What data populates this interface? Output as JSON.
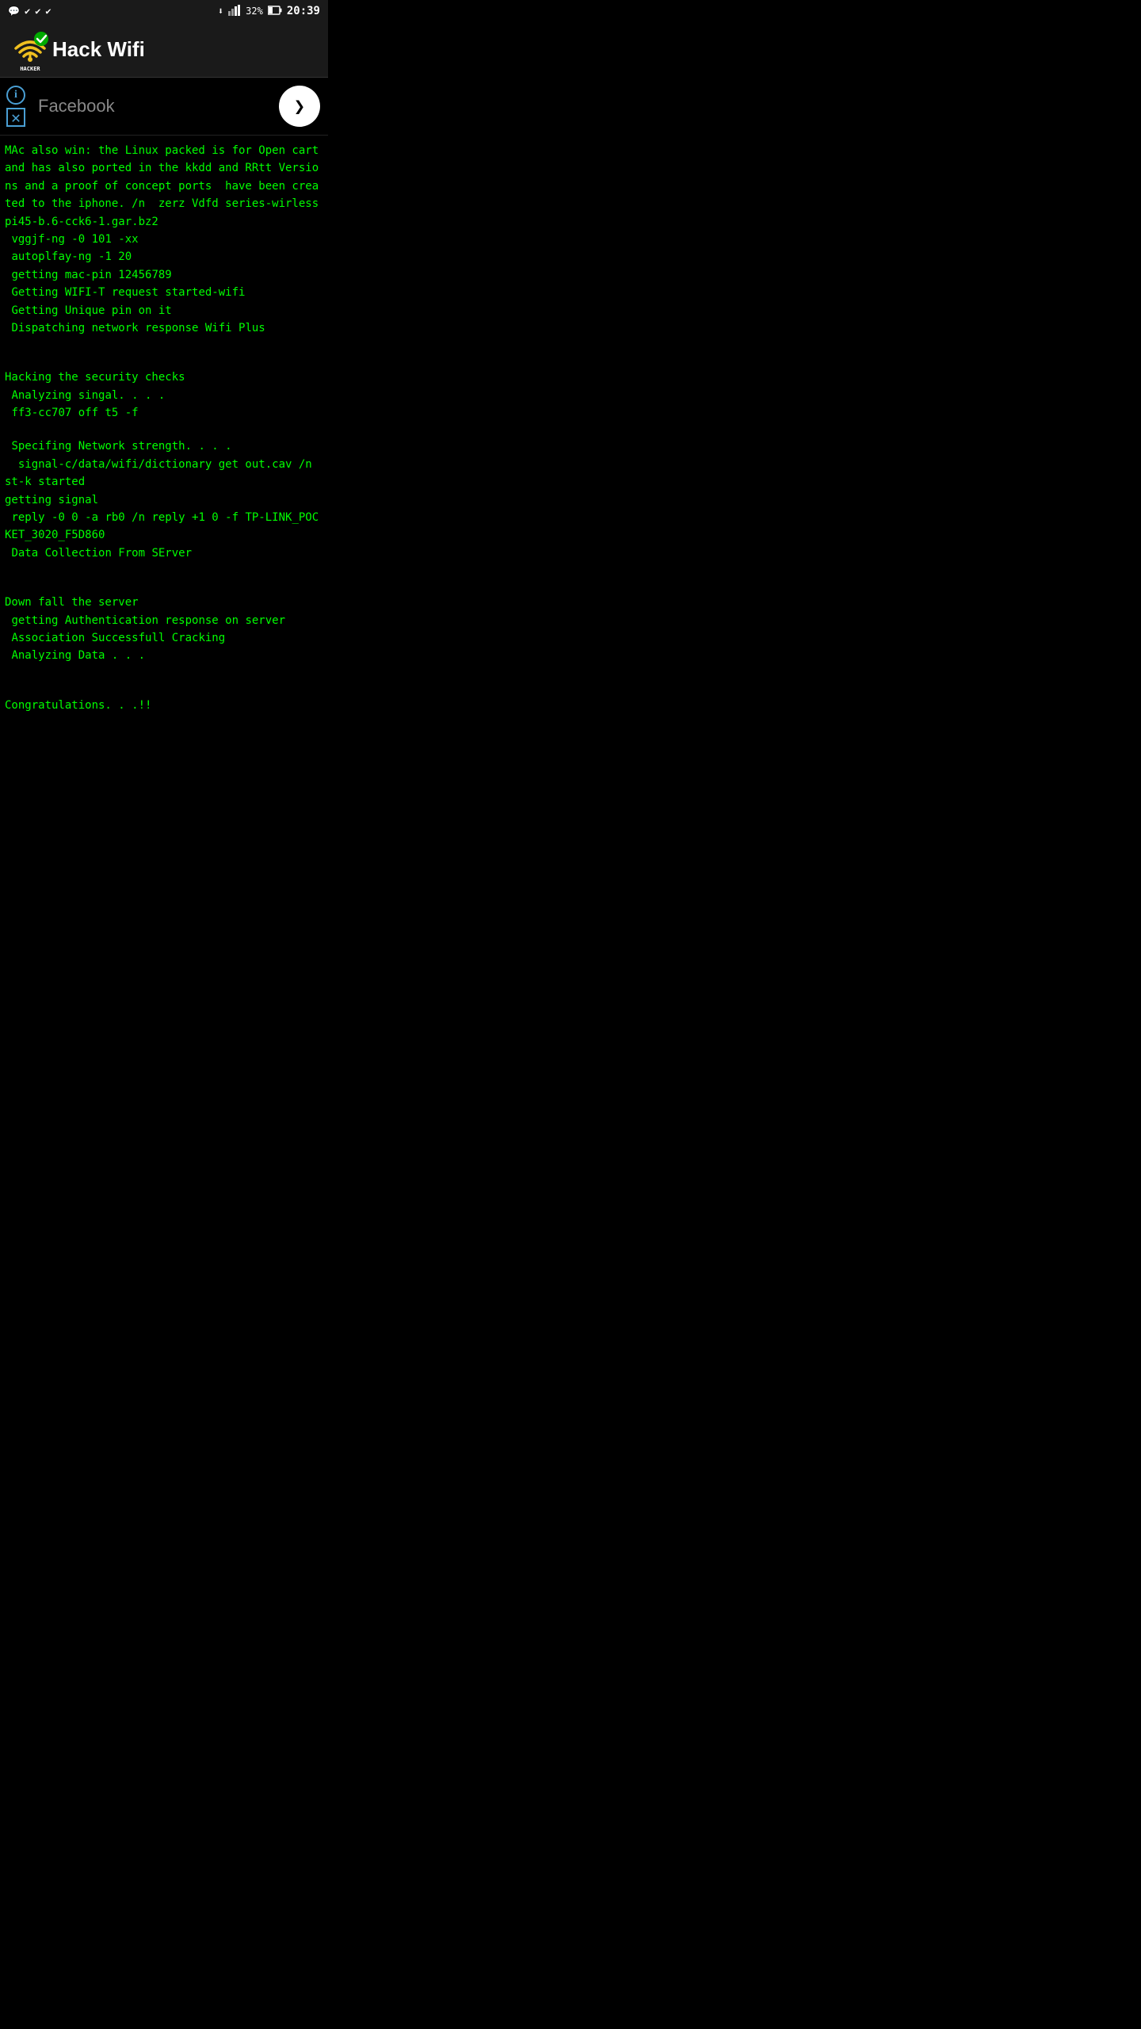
{
  "statusBar": {
    "time": "20:39",
    "battery": "32%",
    "icons": [
      "messenger",
      "check1",
      "check2",
      "check3"
    ]
  },
  "header": {
    "title": "Hack Wifi",
    "logoAlt": "Hacker WiFi logo"
  },
  "adBanner": {
    "text": "Facebook",
    "nextLabel": "❯"
  },
  "terminal": {
    "lines": [
      "MAc also win: the Linux packed is for Open cart and has also ported in the kkdd and RRtt Versions and a proof of concept ports  have been created to the iphone. /n  zerz Vdfd series-wirless pi45-b.6-cck6-1.gar.bz2",
      " vggjf-ng -0 101 -xx",
      " autoplfay-ng -1 20",
      " getting mac-pin 12456789",
      " Getting WIFI-T request started-wifi",
      " Getting Unique pin on it",
      " Dispatching network response Wifi Plus",
      "",
      "",
      "Hacking the security checks",
      " Analyzing singal. . . .",
      " ff3-cc707 off t5 -f",
      "",
      " Specifing Network strength. . . .",
      "  signal-c/data/wifi/dictionary get out.cav /n st-k started",
      "getting signal",
      " reply -0 0 -a rb0 /n reply +1 0 -f TP-LINK_POCKET_3020_F5D860",
      " Data Collection From SErver",
      "",
      "",
      "Down fall the server",
      " getting Authentication response on server",
      " Association Successfull Cracking",
      " Analyzing Data . . .",
      "",
      "",
      "Congratulations. . .!!"
    ]
  }
}
